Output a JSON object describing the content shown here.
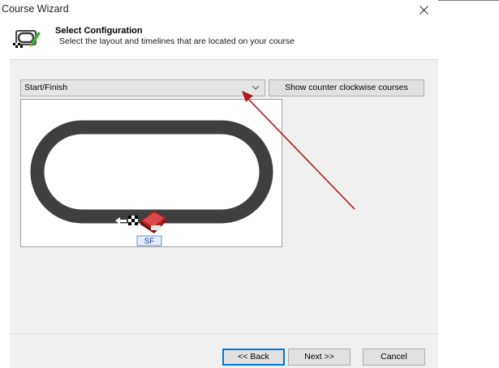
{
  "window": {
    "title": "Course Wizard"
  },
  "header": {
    "title": "Select Configuration",
    "subtitle": "Select the layout and timelines that are located on your course"
  },
  "layout_select": {
    "selected": "Start/Finish"
  },
  "toolbar": {
    "ccw_label": "Show counter clockwise courses"
  },
  "course": {
    "timeline_label": "SF"
  },
  "footer": {
    "back_label": "<< Back",
    "next_label": "Next >>",
    "cancel_label": "Cancel"
  },
  "colors": {
    "track": "#3f3f3f",
    "accent_border": "#0078d7",
    "annotation_arrow": "#b01c1c",
    "timeline_label_bg": "#e3eefb"
  },
  "icons": {
    "wizard": "course-wizard-icon",
    "close": "close-icon",
    "dropdown": "chevron-down-icon",
    "direction": "arrow-left-icon",
    "finish": "checkered-flag-icon",
    "timer": "timing-device-icon"
  }
}
